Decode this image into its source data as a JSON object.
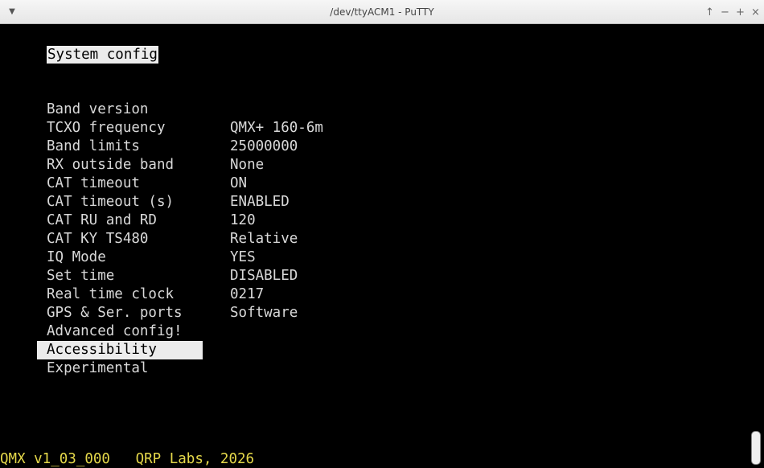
{
  "window": {
    "title": "/dev/ttyACM1 - PuTTY",
    "controls": [
      "↑",
      "−",
      "+",
      "×"
    ]
  },
  "terminal": {
    "header": "System config",
    "items": [
      {
        "label": "Band version",
        "value": "QMX+ 160-6m"
      },
      {
        "label": "TCXO frequency",
        "value": "25000000"
      },
      {
        "label": "Band limits",
        "value": "None"
      },
      {
        "label": "RX outside band",
        "value": "ON"
      },
      {
        "label": "CAT timeout",
        "value": "ENABLED"
      },
      {
        "label": "CAT timeout (s)",
        "value": "120"
      },
      {
        "label": "CAT RU and RD",
        "value": "Relative"
      },
      {
        "label": "CAT KY TS480",
        "value": "YES"
      },
      {
        "label": "IQ Mode",
        "value": "DISABLED"
      },
      {
        "label": "Set time",
        "value": "0217"
      },
      {
        "label": "Real time clock",
        "value": "Software"
      },
      {
        "label": "GPS & Ser. ports",
        "value": ""
      },
      {
        "label": "Advanced config!",
        "value": ""
      },
      {
        "label": "Accessibility",
        "value": ""
      },
      {
        "label": "Experimental",
        "value": ""
      }
    ],
    "selected_index": 13,
    "footer": "QMX v1_03_000   QRP Labs, 2026"
  },
  "colors": {
    "background": "#000000",
    "text": "#d9d9d9",
    "highlight": "#ececec",
    "footer": "#e5d84a"
  }
}
